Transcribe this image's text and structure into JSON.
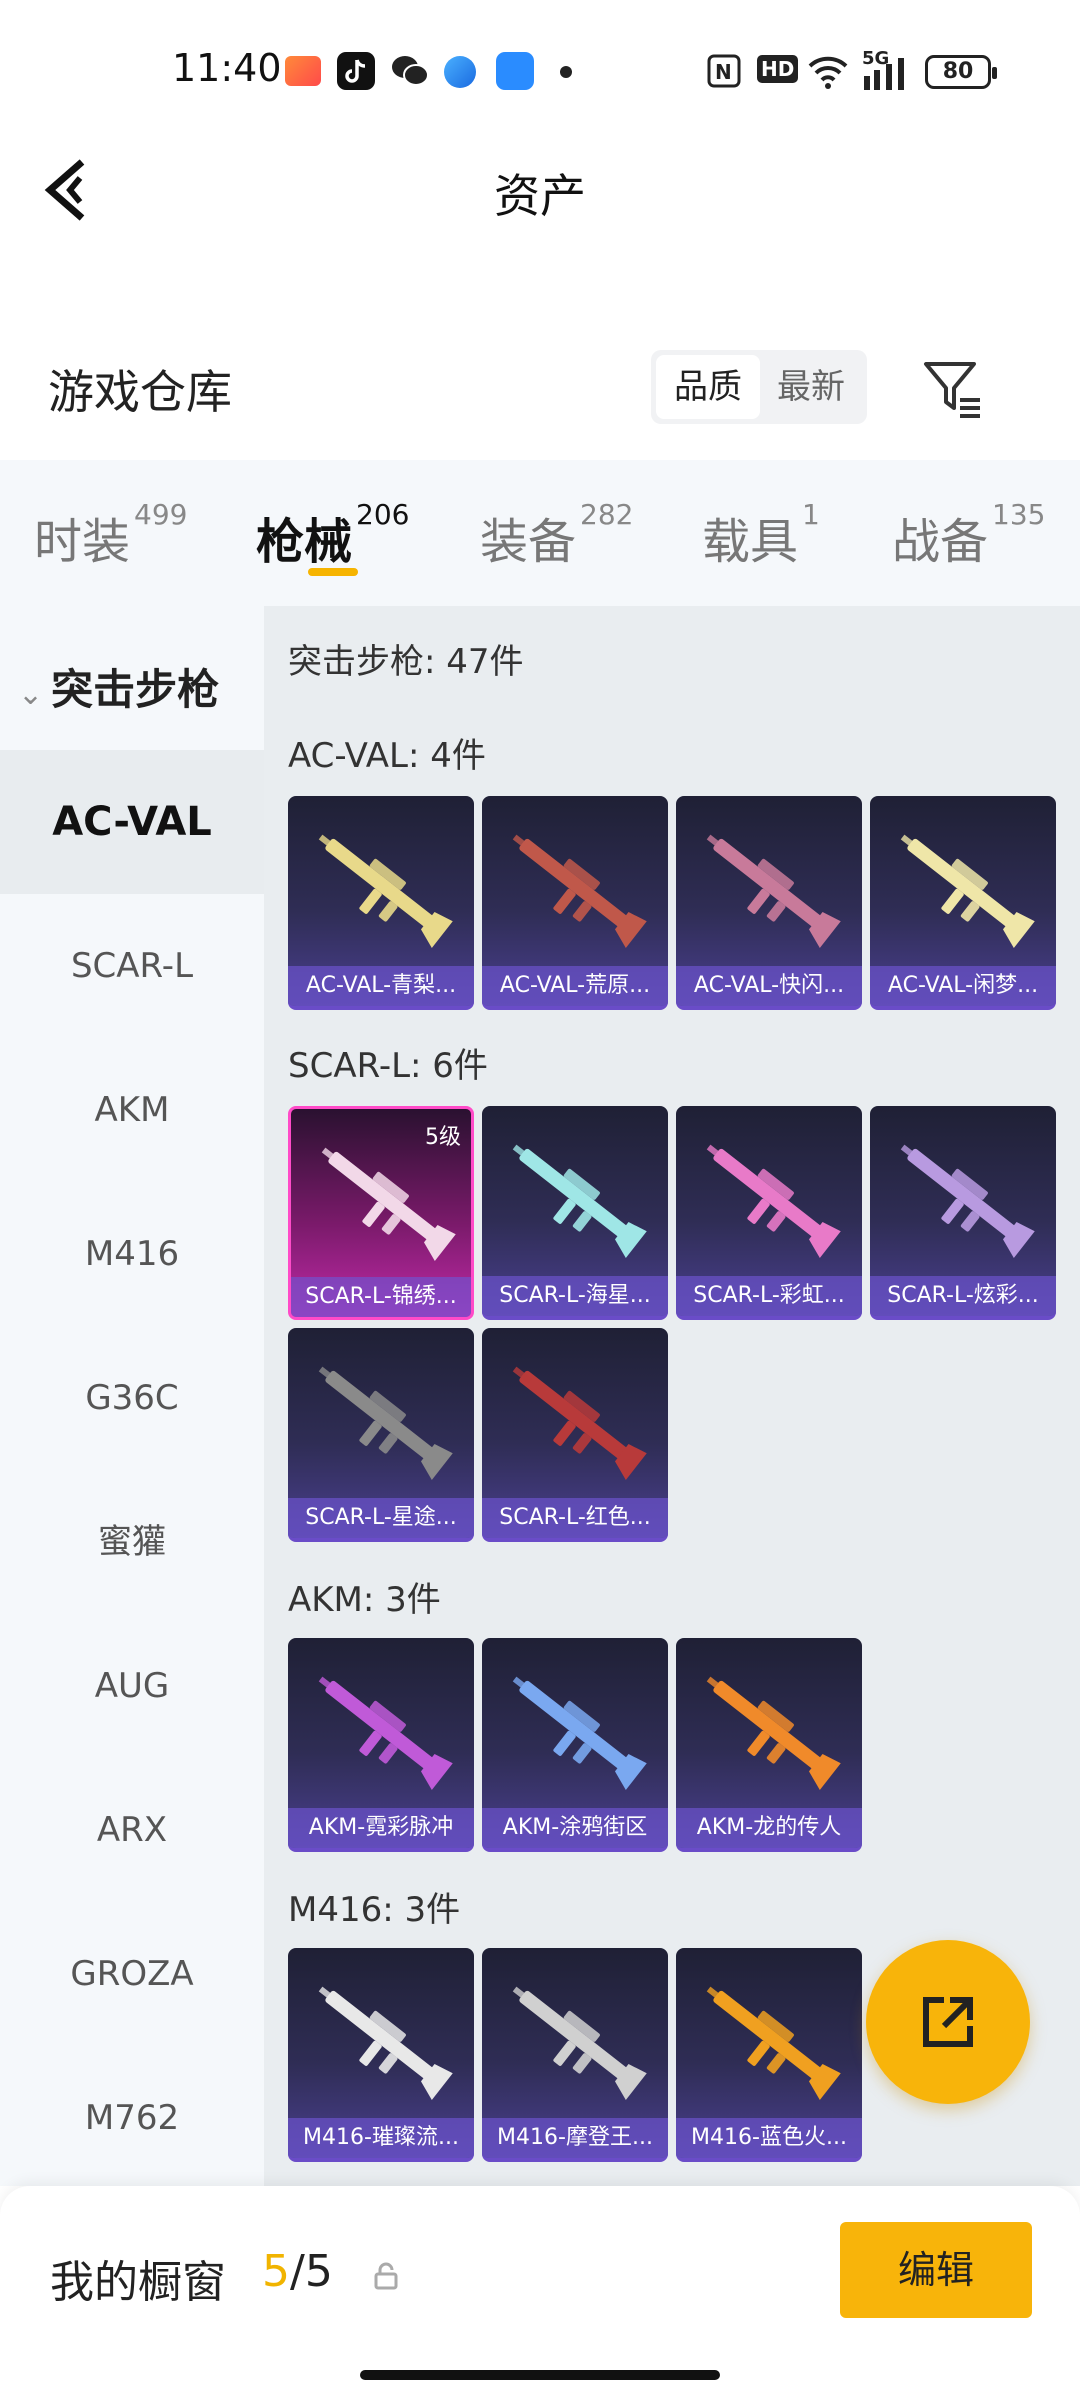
{
  "status_bar": {
    "time": "11:40",
    "network": "5G",
    "hd": "HD",
    "battery": "80",
    "app_icons": [
      "game-icon",
      "tiktok-icon",
      "wechat-icon",
      "browser-icon",
      "app-icon"
    ]
  },
  "header": {
    "title": "资产"
  },
  "warehouse": {
    "title": "游戏仓库",
    "sort_options": [
      "品质",
      "最新"
    ],
    "active_sort": "品质"
  },
  "tabs": [
    {
      "label": "时装",
      "count": "499"
    },
    {
      "label": "枪械",
      "count": "206"
    },
    {
      "label": "装备",
      "count": "282"
    },
    {
      "label": "载具",
      "count": "1"
    },
    {
      "label": "战备",
      "count": "135"
    }
  ],
  "active_tab": "枪械",
  "sidebar": {
    "group": "突击步枪",
    "items": [
      "AC-VAL",
      "SCAR-L",
      "AKM",
      "M416",
      "G36C",
      "蜜獾",
      "AUG",
      "ARX",
      "GROZA",
      "M762"
    ],
    "active": "AC-VAL"
  },
  "content": {
    "total_label": "突击步枪: 47件",
    "sections": [
      {
        "title": "AC-VAL: 4件",
        "items": [
          {
            "label": "AC-VAL-青梨...",
            "color": "#e8d98a"
          },
          {
            "label": "AC-VAL-荒原...",
            "color": "#c0584a"
          },
          {
            "label": "AC-VAL-快闪...",
            "color": "#c87a9a"
          },
          {
            "label": "AC-VAL-闲梦...",
            "color": "#efe6a8"
          }
        ]
      },
      {
        "title": "SCAR-L: 6件",
        "items": [
          {
            "label": "SCAR-L-锦绣...",
            "color": "#f2d8e8",
            "level": "5级"
          },
          {
            "label": "SCAR-L-海星...",
            "color": "#9fe6e6"
          },
          {
            "label": "SCAR-L-彩虹...",
            "color": "#e87ac8"
          },
          {
            "label": "SCAR-L-炫彩...",
            "color": "#b89ae0"
          },
          {
            "label": "SCAR-L-星途...",
            "color": "#8a8a8a"
          },
          {
            "label": "SCAR-L-红色...",
            "color": "#b83a3a"
          }
        ]
      },
      {
        "title": "AKM: 3件",
        "items": [
          {
            "label": "AKM-霓彩脉冲",
            "color": "#c05ad8"
          },
          {
            "label": "AKM-涂鸦街区",
            "color": "#7aa8f0"
          },
          {
            "label": "AKM-龙的传人",
            "color": "#f08a2a"
          }
        ]
      },
      {
        "title": "M416: 3件",
        "items": [
          {
            "label": "M416-璀璨流...",
            "color": "#e8e8e8"
          },
          {
            "label": "M416-摩登王...",
            "color": "#d0d0d0"
          },
          {
            "label": "M416-蓝色火...",
            "color": "#f0a020"
          }
        ]
      }
    ]
  },
  "bottom": {
    "title": "我的橱窗",
    "count_current": "5",
    "count_sep": "/",
    "count_total": "5",
    "edit_label": "编辑"
  },
  "colors": {
    "accent": "#f8b40a",
    "card_bg": "#2f2d55",
    "sidebar_bg": "#f5f8fb"
  }
}
